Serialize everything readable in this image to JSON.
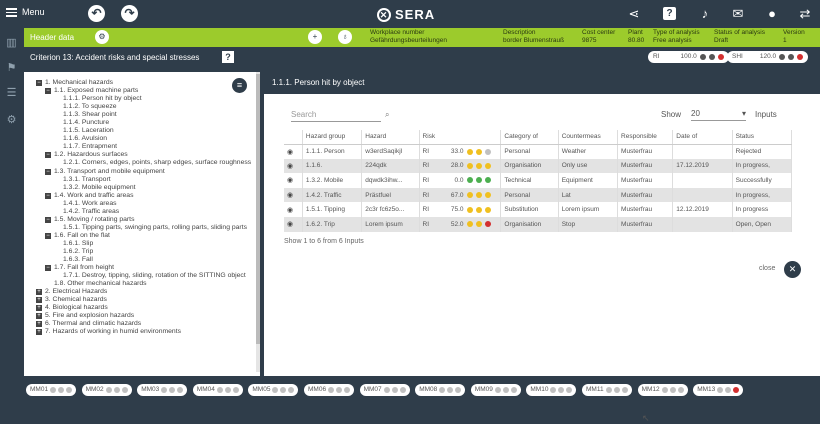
{
  "topbar": {
    "menu_label": "Menu",
    "brand": "SERA",
    "back_symbol": "↶",
    "forward_symbol": "↷"
  },
  "greenbar": {
    "header_label": "Header data",
    "columns": [
      {
        "label": "Workplace number",
        "value": "Gefährdungsbeurteilungen"
      },
      {
        "label": "Description",
        "value": "border Blumenstrauß"
      },
      {
        "label": "Cost center",
        "value": "9875"
      },
      {
        "label": "Plant",
        "value": "80.80"
      },
      {
        "label": "Type of analysis",
        "value": "Free analysis"
      },
      {
        "label": "Status of analysis",
        "value": "Draft"
      },
      {
        "label": "Version",
        "value": "1"
      }
    ]
  },
  "criterion": {
    "title": "Criterion 13: Accident risks and special stresses",
    "ri_label": "RI",
    "ri_value": "100.0",
    "shi_label": "SHI",
    "shi_value": "120.0"
  },
  "tree": [
    {
      "label": "1. Mechanical hazards",
      "level": 0,
      "toggle": "−"
    },
    {
      "label": "1.1. Exposed machine parts",
      "level": 1,
      "toggle": "−"
    },
    {
      "label": "1.1.1. Person hit by object",
      "level": 2,
      "toggle": ""
    },
    {
      "label": "1.1.2. To squeeze",
      "level": 2,
      "toggle": ""
    },
    {
      "label": "1.1.3. Shear point",
      "level": 2,
      "toggle": ""
    },
    {
      "label": "1.1.4. Puncture",
      "level": 2,
      "toggle": ""
    },
    {
      "label": "1.1.5. Laceration",
      "level": 2,
      "toggle": ""
    },
    {
      "label": "1.1.6. Avulsion",
      "level": 2,
      "toggle": ""
    },
    {
      "label": "1.1.7. Entrapment",
      "level": 2,
      "toggle": ""
    },
    {
      "label": "1.2. Hazardous surfaces",
      "level": 1,
      "toggle": "−"
    },
    {
      "label": "1.2.1. Corners, edges, points, sharp edges, surface roughness",
      "level": 2,
      "toggle": ""
    },
    {
      "label": "1.3. Transport and mobile equipment",
      "level": 1,
      "toggle": "−"
    },
    {
      "label": "1.3.1. Transport",
      "level": 2,
      "toggle": ""
    },
    {
      "label": "1.3.2. Mobile equipment",
      "level": 2,
      "toggle": ""
    },
    {
      "label": "1.4. Work and traffic areas",
      "level": 1,
      "toggle": "−"
    },
    {
      "label": "1.4.1. Work areas",
      "level": 2,
      "toggle": ""
    },
    {
      "label": "1.4.2. Traffic areas",
      "level": 2,
      "toggle": ""
    },
    {
      "label": "1.5. Moving / rotating parts",
      "level": 1,
      "toggle": "−"
    },
    {
      "label": "1.5.1. Tipping parts, swinging parts, rolling parts, sliding parts",
      "level": 2,
      "toggle": ""
    },
    {
      "label": "1.6. Fall on the flat",
      "level": 1,
      "toggle": "−"
    },
    {
      "label": "1.6.1. Slip",
      "level": 2,
      "toggle": ""
    },
    {
      "label": "1.6.2. Trip",
      "level": 2,
      "toggle": ""
    },
    {
      "label": "1.6.3. Fall",
      "level": 2,
      "toggle": ""
    },
    {
      "label": "1.7. Fall from height",
      "level": 1,
      "toggle": "−"
    },
    {
      "label": "1.7.1. Destroy, tipping, sliding, rotation of the SITTING object",
      "level": 2,
      "toggle": ""
    },
    {
      "label": "1.8. Other mechanical hazards",
      "level": 1,
      "toggle": ""
    },
    {
      "label": "2. Electrical Hazards",
      "level": 0,
      "toggle": "+"
    },
    {
      "label": "3. Chemical hazards",
      "level": 0,
      "toggle": "+"
    },
    {
      "label": "4. Biological hazards",
      "level": 0,
      "toggle": "+"
    },
    {
      "label": "5. Fire and explosion hazards",
      "level": 0,
      "toggle": "+"
    },
    {
      "label": "6. Thermal and climatic hazards",
      "level": 0,
      "toggle": "+"
    },
    {
      "label": "7. Hazards of working in humid environments",
      "level": 0,
      "toggle": "+"
    }
  ],
  "main": {
    "title": "1.1.1. Person hit by object",
    "search_placeholder": "Search",
    "show_label": "Show",
    "show_value": "20",
    "inputs_label": "Inputs",
    "columns": [
      "",
      "Hazard group",
      "Hazard",
      "Risk",
      "Category of",
      "Countermeas",
      "Responsible",
      "Date of",
      "Status"
    ],
    "rows": [
      {
        "group": "1.1.1. Person",
        "hazard": "w3erdSaqikjl",
        "risk_label": "RI",
        "risk_value": "33.0",
        "dots": [
          "#f0c020",
          "#f0c020",
          "#c0c0c0"
        ],
        "category": "Personal",
        "counter": "Weather",
        "responsible": "Musterfrau",
        "date": "",
        "status": "Rejected"
      },
      {
        "group": "1.1.6.",
        "hazard": "224qdk",
        "risk_label": "RI",
        "risk_value": "28.0",
        "dots": [
          "#f0c020",
          "#f0c020",
          "#f0c020"
        ],
        "category": "Organisation",
        "counter": "Only use",
        "responsible": "Musterfrau",
        "date": "17.12.2019",
        "status": "In progress,"
      },
      {
        "group": "1.3.2. Mobile",
        "hazard": "dqwdk3ihw...",
        "risk_label": "RI",
        "risk_value": "0.0",
        "dots": [
          "#4caf50",
          "#4caf50",
          "#4caf50"
        ],
        "category": "Technical",
        "counter": "Equipment",
        "responsible": "Musterfrau",
        "date": "",
        "status": "Successfully"
      },
      {
        "group": "1.4.2. Traffic",
        "hazard": "Prästfuel",
        "risk_label": "RI",
        "risk_value": "67.0",
        "dots": [
          "#f0c020",
          "#f0c020",
          "#f0c020"
        ],
        "category": "Personal",
        "counter": "Lat",
        "responsible": "Musterfrau",
        "date": "",
        "status": "In progress,"
      },
      {
        "group": "1.5.1. Tipping",
        "hazard": "2c3r fc6z5o...",
        "risk_label": "RI",
        "risk_value": "75.0",
        "dots": [
          "#f0c020",
          "#f0c020",
          "#f0c020"
        ],
        "category": "Substitution",
        "counter": "Lorem ipsum",
        "responsible": "Musterfrau",
        "date": "12.12.2019",
        "status": "In progress"
      },
      {
        "group": "1.6.2. Trip",
        "hazard": "Lorem ipsum",
        "risk_label": "RI",
        "risk_value": "52.0",
        "dots": [
          "#f0c020",
          "#f0c020",
          "#d32f2f"
        ],
        "category": "Organisation",
        "counter": "Stop",
        "responsible": "Musterfrau",
        "date": "",
        "status": "Open, Open"
      }
    ],
    "footer_text": "Show 1 to 6 from 6 Inputs",
    "close_label": "close"
  },
  "bottom_tabs": [
    {
      "label": "MM01",
      "dots": [
        "#c0c0c0",
        "#c0c0c0",
        "#c0c0c0"
      ]
    },
    {
      "label": "MM02",
      "dots": [
        "#c0c0c0",
        "#c0c0c0",
        "#c0c0c0"
      ]
    },
    {
      "label": "MM03",
      "dots": [
        "#c0c0c0",
        "#c0c0c0",
        "#c0c0c0"
      ]
    },
    {
      "label": "MM04",
      "dots": [
        "#c0c0c0",
        "#c0c0c0",
        "#c0c0c0"
      ]
    },
    {
      "label": "MM05",
      "dots": [
        "#c0c0c0",
        "#c0c0c0",
        "#c0c0c0"
      ]
    },
    {
      "label": "MM06",
      "dots": [
        "#c0c0c0",
        "#c0c0c0",
        "#c0c0c0"
      ]
    },
    {
      "label": "MM07",
      "dots": [
        "#c0c0c0",
        "#c0c0c0",
        "#c0c0c0"
      ]
    },
    {
      "label": "MM08",
      "dots": [
        "#c0c0c0",
        "#c0c0c0",
        "#c0c0c0"
      ]
    },
    {
      "label": "MM09",
      "dots": [
        "#c0c0c0",
        "#c0c0c0",
        "#c0c0c0"
      ]
    },
    {
      "label": "MM10",
      "dots": [
        "#c0c0c0",
        "#c0c0c0",
        "#c0c0c0"
      ]
    },
    {
      "label": "MM11",
      "dots": [
        "#c0c0c0",
        "#c0c0c0",
        "#c0c0c0"
      ]
    },
    {
      "label": "MM12",
      "dots": [
        "#c0c0c0",
        "#c0c0c0",
        "#c0c0c0"
      ]
    },
    {
      "label": "MM13",
      "dots": [
        "#c0c0c0",
        "#c0c0c0",
        "#d32f2f"
      ]
    }
  ],
  "colors": {
    "navy": "#2f3d4a",
    "green": "#9ccb2c",
    "yellow": "#f0c020",
    "red": "#d32f2f",
    "grey": "#c0c0c0"
  }
}
